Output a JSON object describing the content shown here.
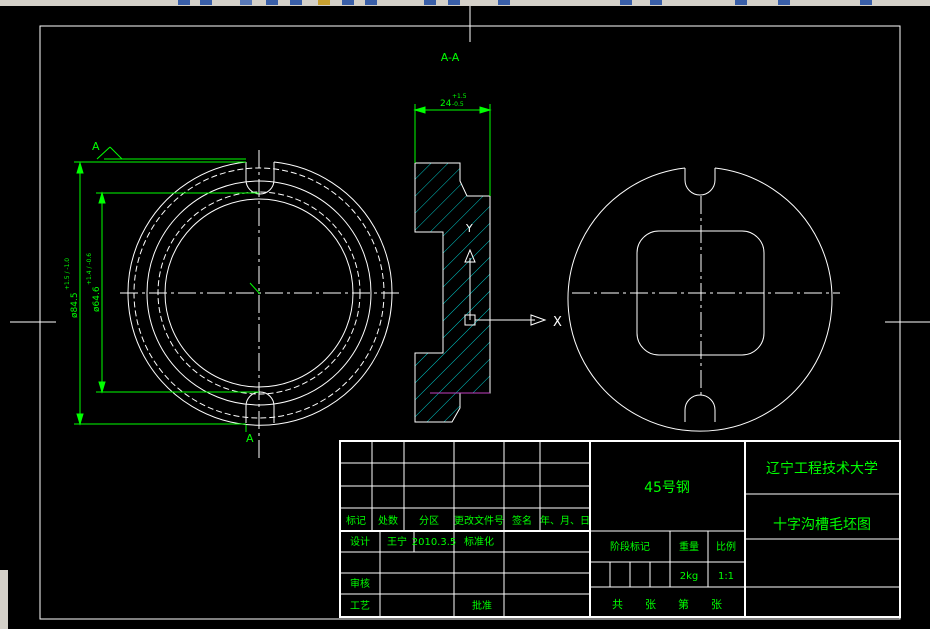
{
  "drawing": {
    "section_title": "A-A",
    "section_letter_top": "A",
    "section_letter_bottom": "A",
    "dim_width": "24",
    "dim_width_tol_upper": "+1.5",
    "dim_width_tol_lower": "-0.5",
    "dim_outer_dia": "ø84.5",
    "dim_outer_tol": "+1.5 / -1.0",
    "dim_inner_dia": "ø64.6",
    "dim_inner_tol": "+1.4 / -0.6",
    "ucs_y": "Y",
    "ucs_x": "X"
  },
  "title_block": {
    "material": "45号钢",
    "school": "辽宁工程技术大学",
    "drawing_name": "十字沟槽毛坯图",
    "row_headers": [
      "标记",
      "处数",
      "分区",
      "更改文件号",
      "签名",
      "年、月、日"
    ],
    "designer_label": "设计",
    "designer_name": "王宁",
    "design_date": "2010.3.5",
    "standardize_label": "标准化",
    "stage_label": "阶段标记",
    "weight_label": "重量",
    "scale_label": "比例",
    "weight_value": "2kg",
    "scale_value": "1:1",
    "review_label": "审核",
    "process_label": "工艺",
    "approve_label": "批准",
    "sheets_text": "共　　张　　第　　张"
  },
  "colors": {
    "background": "#000000",
    "lines": "#ffffff",
    "dimensions": "#00ff00",
    "hatch": "#00c8c8",
    "text": "#00ff00"
  }
}
